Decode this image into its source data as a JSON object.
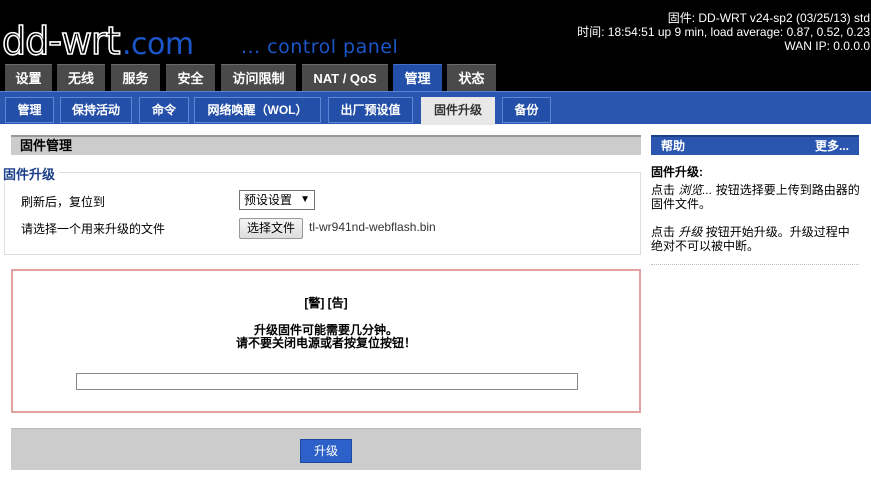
{
  "header": {
    "logo_text": "dd-wrt.com",
    "subtitle": "... control panel",
    "status_firmware": "固件: DD-WRT v24-sp2 (03/25/13) std",
    "status_time": "时间: 18:54:51 up 9 min, load average: 0.87, 0.52, 0.23",
    "status_wan": "WAN IP: 0.0.0.0"
  },
  "main_tabs": [
    "设置",
    "无线",
    "服务",
    "安全",
    "访问限制",
    "NAT / QoS",
    "管理",
    "状态"
  ],
  "sub_tabs": [
    "管理",
    "保持活动",
    "命令",
    "网络唤醒（WOL）",
    "出厂预设值",
    "固件升级",
    "备份"
  ],
  "section": {
    "title": "固件管理",
    "legend": "固件升级",
    "reset_label": "刷新后，复位到",
    "reset_value": "预设设置",
    "file_label": "请选择一个用来升级的文件",
    "file_button": "选择文件",
    "file_name": "tl-wr941nd-webflash.bin"
  },
  "warning": {
    "title": "[警] [告]",
    "line1": "升级固件可能需要几分钟。",
    "line2": "请不要关闭电源或者按复位按钮！",
    "progress": 0
  },
  "footer": {
    "upgrade_button": "升级"
  },
  "help": {
    "header": "帮助",
    "more": "更多...",
    "title": "固件升级:",
    "p1_a": "点击 ",
    "p1_em": "浏览...",
    "p1_b": " 按钮选择要上传到路由器的固件文件。",
    "p2_a": "点击 ",
    "p2_em": "升级",
    "p2_b": " 按钮开始升级。升级过程中绝对不可以被中断。"
  },
  "colors": {
    "header_bg": "#000000",
    "accent_blue": "#2a56b0",
    "logo_blue": "#1b56c9",
    "warning_border": "#e6a1a3",
    "section_gray": "#cccccc"
  }
}
